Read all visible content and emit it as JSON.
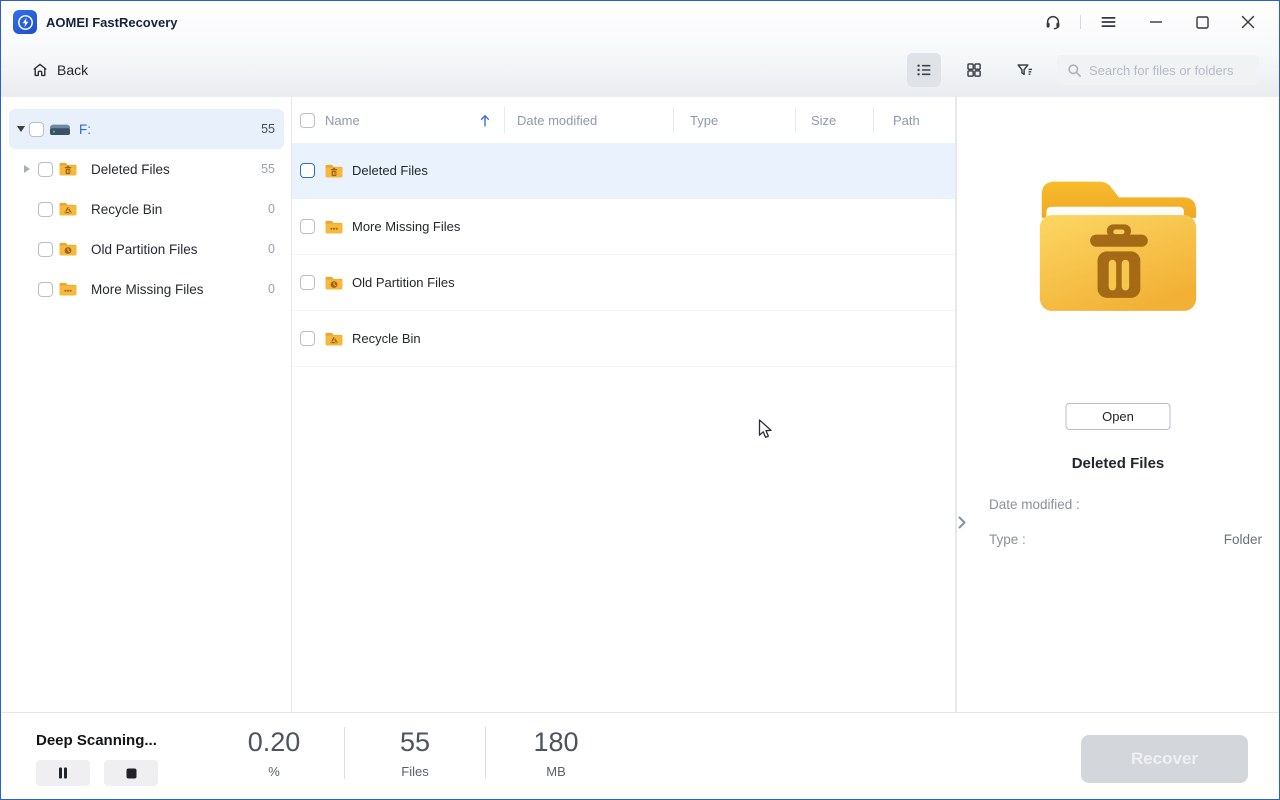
{
  "titlebar": {
    "app_title": "AOMEI FastRecovery"
  },
  "toolbar": {
    "back_label": "Back",
    "search_placeholder": "Search for files or folders"
  },
  "sidebar": {
    "items": [
      {
        "label": "F:",
        "count": "55",
        "icon": "drive"
      },
      {
        "label": "Deleted Files",
        "count": "55",
        "icon": "folder-trash"
      },
      {
        "label": "Recycle Bin",
        "count": "0",
        "icon": "folder-recycle"
      },
      {
        "label": "Old Partition Files",
        "count": "0",
        "icon": "folder-clock"
      },
      {
        "label": "More Missing Files",
        "count": "0",
        "icon": "folder-dots"
      }
    ]
  },
  "table": {
    "columns": [
      "Name",
      "Date modified",
      "Type",
      "Size",
      "Path"
    ],
    "rows": [
      {
        "name": "Deleted Files",
        "icon": "folder-trash"
      },
      {
        "name": "More Missing Files",
        "icon": "folder-dots"
      },
      {
        "name": "Old Partition Files",
        "icon": "folder-clock"
      },
      {
        "name": "Recycle Bin",
        "icon": "folder-recycle"
      }
    ]
  },
  "preview": {
    "open_label": "Open",
    "title": "Deleted Files",
    "date_label": "Date modified :",
    "date_value": "",
    "type_label": "Type :",
    "type_value": "Folder"
  },
  "footer": {
    "status": "Deep Scanning...",
    "stats": [
      {
        "value": "0.20",
        "unit": "%"
      },
      {
        "value": "55",
        "unit": "Files"
      },
      {
        "value": "180",
        "unit": "MB"
      }
    ],
    "recover_label": "Recover"
  },
  "colors": {
    "accent_border": "#2b5ce0",
    "selection_blue": "#e8f0fb",
    "folder_gold": "#f6b93c",
    "folder_glyph_brown": "#9b661c"
  }
}
